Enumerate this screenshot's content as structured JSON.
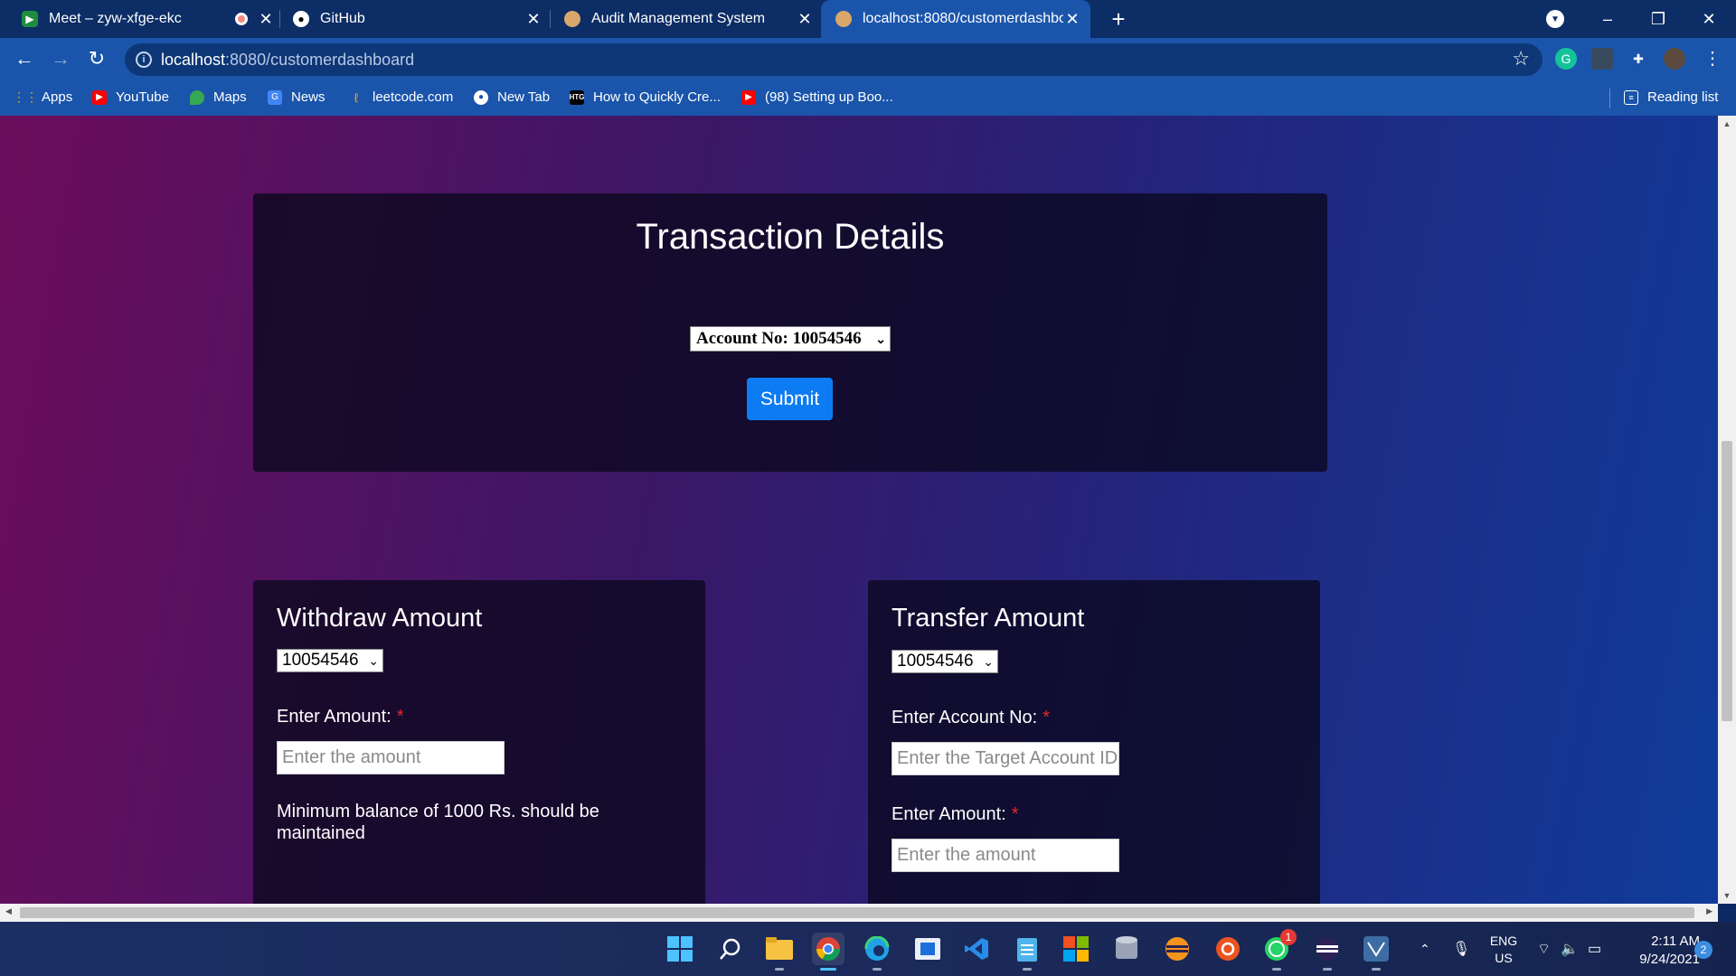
{
  "browser": {
    "tabs": [
      {
        "title": "Meet – zyw-xfge-ekc",
        "icon": "meet-icon"
      },
      {
        "title": "GitHub",
        "icon": "github-icon"
      },
      {
        "title": "Audit Management System",
        "icon": "app-icon"
      },
      {
        "title": "localhost:8080/customerdashboard",
        "icon": "app-icon",
        "active": true
      }
    ],
    "url_host": "localhost",
    "url_rest": ":8080/customerdashboard",
    "bookmarks": [
      "Apps",
      "YouTube",
      "Maps",
      "News",
      "leetcode.com",
      "New Tab",
      "How to Quickly Cre...",
      "(98) Setting up Boo..."
    ],
    "reading_list": "Reading list"
  },
  "page": {
    "transaction": {
      "title": "Transaction Details",
      "account_select": "Account No: 10054546",
      "submit": "Submit"
    },
    "withdraw": {
      "title": "Withdraw Amount",
      "account_select": "10054546",
      "amount_label": "Enter Amount:",
      "amount_placeholder": "Enter the amount",
      "note": "Minimum balance of 1000 Rs. should be maintained"
    },
    "transfer": {
      "title": "Transfer Amount",
      "account_select": "10054546",
      "target_label": "Enter Account No:",
      "target_placeholder": "Enter the Target Account ID",
      "amount_label": "Enter Amount:",
      "amount_placeholder": "Enter the amount"
    },
    "required_mark": "*"
  },
  "taskbar": {
    "lang_top": "ENG",
    "lang_bottom": "US",
    "time": "2:11 AM",
    "date": "9/24/2021",
    "notifications": "2",
    "whatsapp_badge": "1"
  },
  "colors": {
    "submit_button": "#0d7cf2",
    "chrome_toolbar": "#1a55ab",
    "required": "#e8262b"
  }
}
